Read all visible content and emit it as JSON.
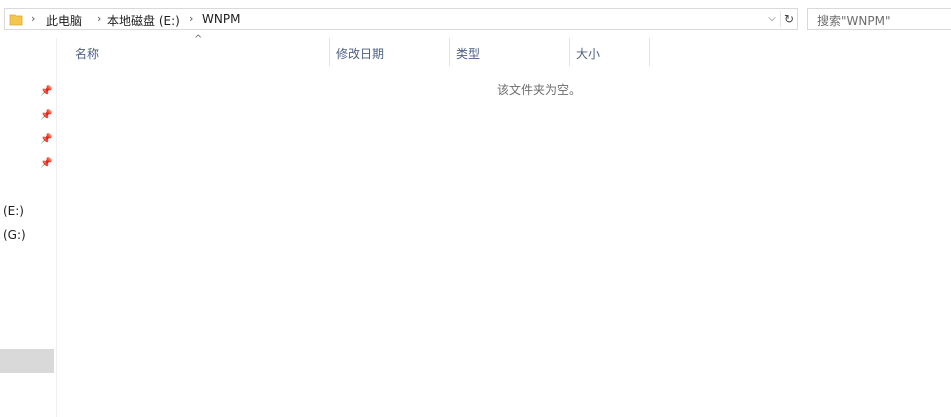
{
  "breadcrumb": {
    "items": [
      "此电脑",
      "本地磁盘 (E:)",
      "WNPM"
    ]
  },
  "search": {
    "placeholder": "搜索\"WNPM\""
  },
  "nav_pane": {
    "drives": [
      "(E:)",
      "(G:)"
    ]
  },
  "columns": [
    {
      "label": "名称"
    },
    {
      "label": "修改日期"
    },
    {
      "label": "类型"
    },
    {
      "label": "大小"
    }
  ],
  "empty_message": "该文件夹为空。",
  "colors": {
    "folder": "#f4c64c",
    "header_text": "#4d6082"
  }
}
